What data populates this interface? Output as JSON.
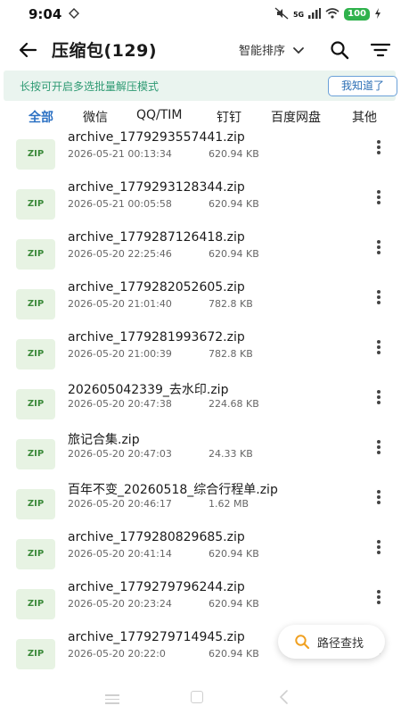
{
  "status_bar": {
    "time": "9:04",
    "network": "5G",
    "battery": "100"
  },
  "header": {
    "title": "压缩包(129)",
    "sort_label": "智能排序"
  },
  "banner": {
    "text": "长按可开启多选批量解压模式",
    "button_label": "我知道了"
  },
  "tabs": [
    {
      "label": "全部",
      "active": true
    },
    {
      "label": "微信",
      "active": false
    },
    {
      "label": "QQ/TIM",
      "active": false
    },
    {
      "label": "钉钉",
      "active": false
    },
    {
      "label": "百度网盘",
      "active": false
    },
    {
      "label": "其他",
      "active": false
    }
  ],
  "files": [
    {
      "icon": "ZIP",
      "name": "archive_1779293557441.zip",
      "date": "2026-05-21 00:13:34",
      "size": "620.94 KB"
    },
    {
      "icon": "ZIP",
      "name": "archive_1779293128344.zip",
      "date": "2026-05-21 00:05:58",
      "size": "620.94 KB"
    },
    {
      "icon": "ZIP",
      "name": "archive_1779287126418.zip",
      "date": "2026-05-20 22:25:46",
      "size": "620.94 KB"
    },
    {
      "icon": "ZIP",
      "name": "archive_1779282052605.zip",
      "date": "2026-05-20 21:01:40",
      "size": "782.8 KB"
    },
    {
      "icon": "ZIP",
      "name": "archive_1779281993672.zip",
      "date": "2026-05-20 21:00:39",
      "size": "782.8 KB"
    },
    {
      "icon": "ZIP",
      "name": "202605042339_去水印.zip",
      "date": "2026-05-20 20:47:38",
      "size": "224.68 KB"
    },
    {
      "icon": "ZIP",
      "name": "旅记合集.zip",
      "date": "2026-05-20 20:47:03",
      "size": "24.33 KB"
    },
    {
      "icon": "ZIP",
      "name": "百年不变_20260518_综合行程单.zip",
      "date": "2026-05-20 20:46:17",
      "size": "1.62 MB"
    },
    {
      "icon": "ZIP",
      "name": "archive_1779280829685.zip",
      "date": "2026-05-20 20:41:14",
      "size": "620.94 KB"
    },
    {
      "icon": "ZIP",
      "name": "archive_1779279796244.zip",
      "date": "2026-05-20 20:23:24",
      "size": "620.94 KB"
    },
    {
      "icon": "ZIP",
      "name": "archive_1779279714945.zip",
      "date": "2026-05-20 20:22:0",
      "size": "620.94 KB"
    }
  ],
  "fab": {
    "label": "路径查找"
  },
  "colors": {
    "accent": "#2d72c4",
    "banner_bg": "#eaf4ef",
    "banner_text": "#2e9a73",
    "zip_icon_bg": "#e7f3e3",
    "fab_icon": "#f0a020"
  }
}
